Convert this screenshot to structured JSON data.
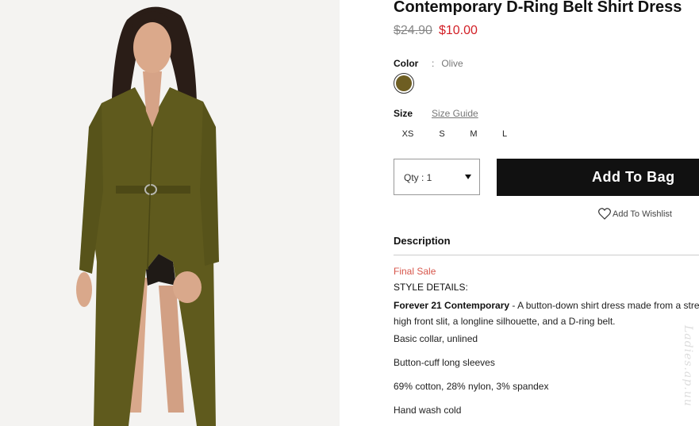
{
  "product": {
    "title": "Contemporary D-Ring Belt Shirt Dress",
    "old_price": "$24.90",
    "price": "$10.00"
  },
  "color": {
    "label": "Color",
    "separator": ":",
    "value": "Olive",
    "swatch_hex": "#6e5e22"
  },
  "size": {
    "label": "Size",
    "guide": "Size Guide",
    "options": [
      "XS",
      "S",
      "M",
      "L"
    ]
  },
  "qty": {
    "label": "Qty : 1"
  },
  "buttons": {
    "add_to_bag": "Add To Bag",
    "wishlist": "Add To Wishlist"
  },
  "description": {
    "heading": "Description",
    "final_sale": "Final Sale",
    "style_details": "STYLE DETAILS:",
    "brand": "Forever 21 Contemporary",
    "line1_rest": " - A button-down shirt dress made from a stre",
    "line2": "high front slit, a longline silhouette, and a D-ring belt.",
    "bullets": [
      "Basic collar, unlined",
      "Button-cuff long sleeves",
      "69% cotton, 28% nylon, 3% spandex",
      "Hand wash cold"
    ]
  },
  "watermark": "Ladies.ap.uu",
  "accent": {
    "price_red": "#d21f26",
    "final_sale": "#d7564b",
    "button": "#111111"
  }
}
